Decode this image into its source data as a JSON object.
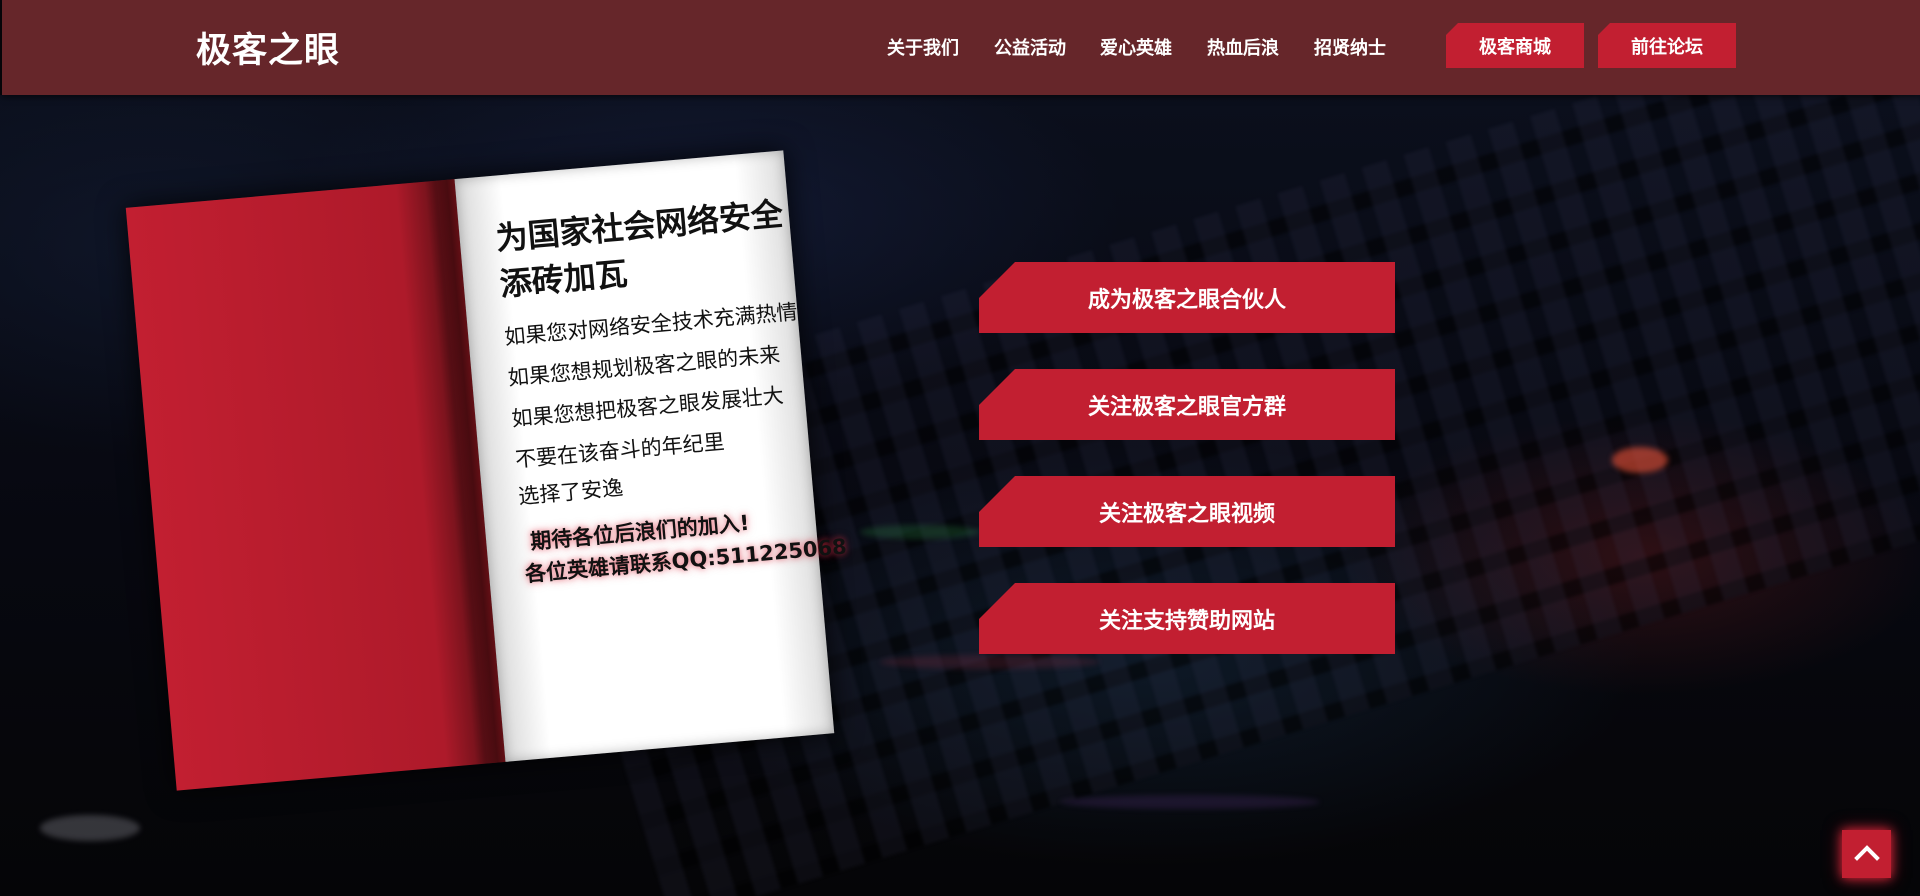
{
  "site": {
    "logo_text": "极客之眼"
  },
  "nav": {
    "items": [
      {
        "label": "关于我们"
      },
      {
        "label": "公益活动"
      },
      {
        "label": "爱心英雄"
      },
      {
        "label": "热血后浪"
      },
      {
        "label": "招贤纳士"
      }
    ],
    "buttons": [
      {
        "label": "极客商城"
      },
      {
        "label": "前往论坛"
      }
    ]
  },
  "book": {
    "title_line1": "为国家社会网络安全",
    "title_line2": "添砖加瓦",
    "lines": [
      "如果您对网络安全技术充满热情",
      "如果您想规划极客之眼的未来",
      "如果您想把极客之眼发展壮大",
      "不要在该奋斗的年纪里",
      "选择了安逸"
    ],
    "cta_line1": "期待各位后浪们的加入!",
    "cta_line2": "各位英雄请联系QQ:511225068"
  },
  "actions": [
    {
      "label": "成为极客之眼合伙人"
    },
    {
      "label": "关注极客之眼官方群"
    },
    {
      "label": "关注极客之眼视频"
    },
    {
      "label": "关注支持赞助网站"
    }
  ],
  "back_to_top": {
    "icon": "chevron-up-icon"
  },
  "colors": {
    "header_bg": "#66262a",
    "accent_red": "#c21f31",
    "page_bg": "#ffffff"
  }
}
